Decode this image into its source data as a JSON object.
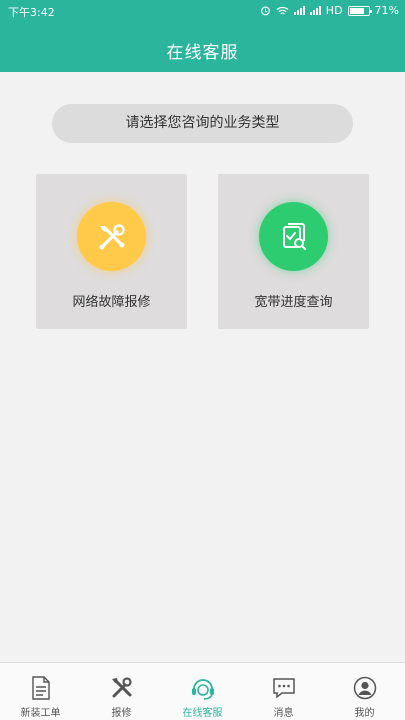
{
  "status_bar": {
    "time": "下午3:42",
    "network": "HD",
    "battery": "71%"
  },
  "header": {
    "title": "在线客服"
  },
  "main": {
    "prompt": "请选择您咨询的业务类型",
    "cards": [
      {
        "label": "网络故障报修",
        "icon": "tools-icon",
        "color": "#ffc94a"
      },
      {
        "label": "宽带进度查询",
        "icon": "document-search-icon",
        "color": "#2ecc71"
      }
    ]
  },
  "tabbar": {
    "items": [
      {
        "label": "新装工单",
        "icon": "document-icon"
      },
      {
        "label": "报修",
        "icon": "tools-icon"
      },
      {
        "label": "在线客服",
        "icon": "headset-icon",
        "active": true
      },
      {
        "label": "消息",
        "icon": "chat-icon"
      },
      {
        "label": "我的",
        "icon": "user-icon"
      }
    ]
  },
  "colors": {
    "accent": "#2bb59d",
    "background": "#f2f2f2"
  }
}
